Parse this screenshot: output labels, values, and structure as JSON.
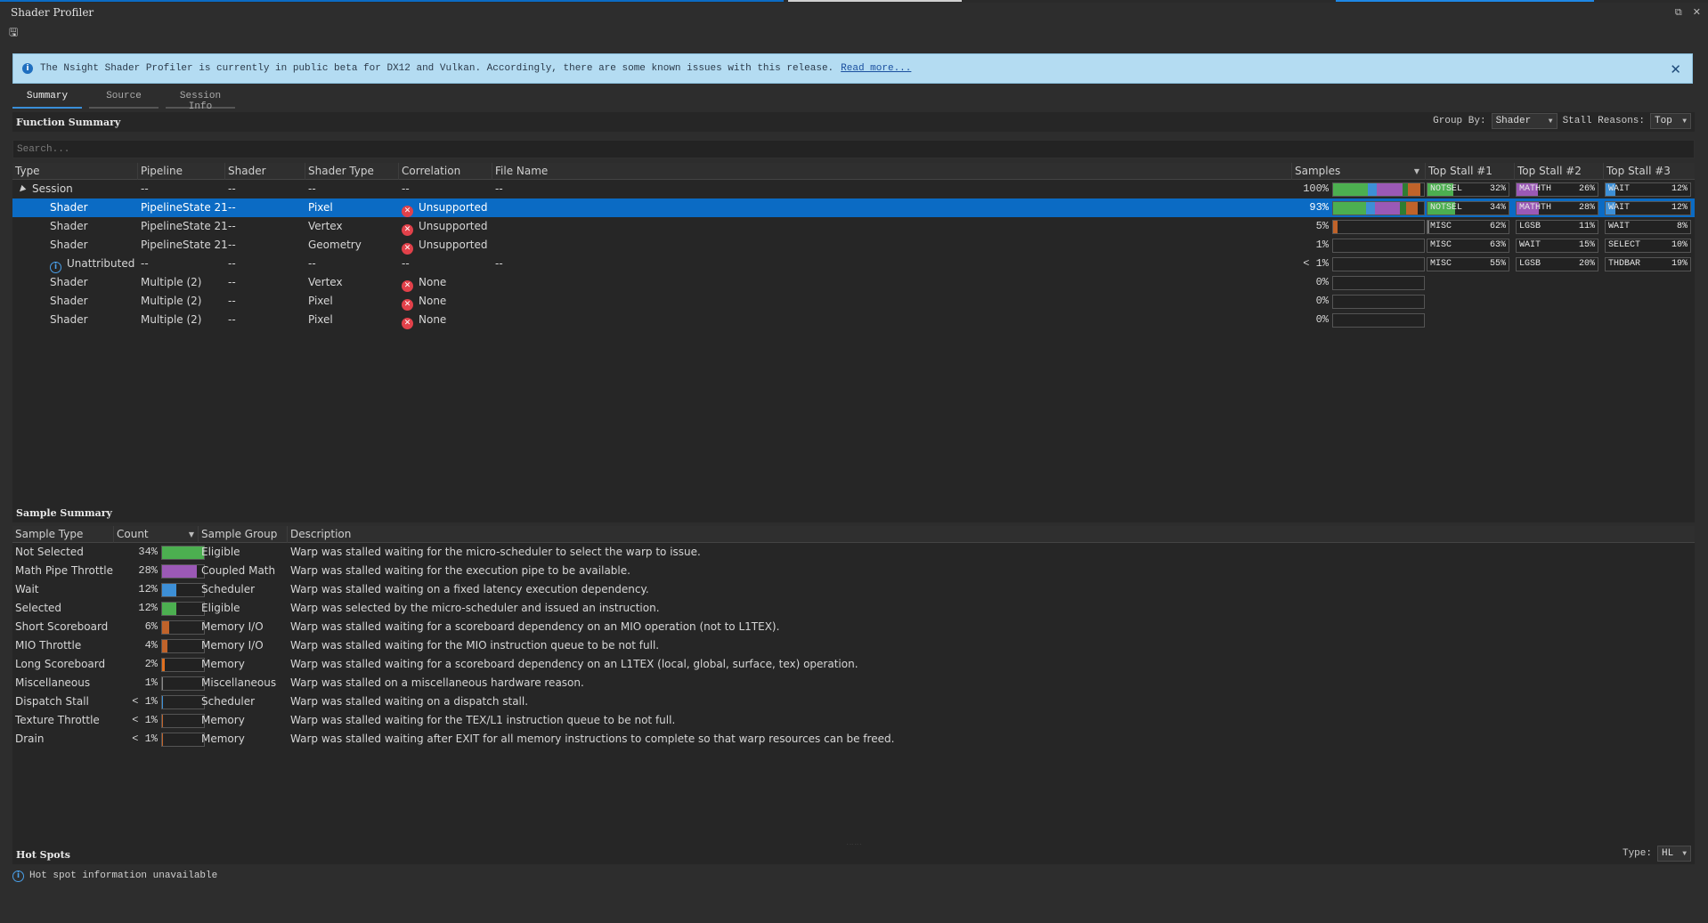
{
  "window": {
    "title": "Shader Profiler",
    "toolbar_icon": "save-icon"
  },
  "colors": {
    "accent": "#0b6bc4",
    "banner_bg": "#b4dcf2",
    "not_selected": "#4caf50",
    "math": "#9b59b6",
    "wait": "#3d8fd6",
    "memory": "#c0632a",
    "error": "#e2414a"
  },
  "banner": {
    "message": "The Nsight Shader Profiler is currently in public beta for DX12 and Vulkan. Accordingly, there are some known issues with this release.",
    "link": "Read more...",
    "close": "✕"
  },
  "tabs": [
    {
      "label": "Summary",
      "active": true
    },
    {
      "label": "Source",
      "active": false
    },
    {
      "label": "Session Info",
      "active": false
    }
  ],
  "function_summary": {
    "title": "Function Summary",
    "group_by_label": "Group By:",
    "group_by_value": "Shader",
    "stall_reasons_label": "Stall Reasons:",
    "stall_reasons_value": "Top",
    "search_placeholder": "Search...",
    "columns": {
      "type": "Type",
      "pipeline": "Pipeline",
      "shader": "Shader",
      "shader_type": "Shader Type",
      "correlation": "Correlation",
      "file_name": "File Name",
      "samples": "Samples",
      "top1": "Top Stall #1",
      "top2": "Top Stall #2",
      "top3": "Top Stall #3"
    },
    "rows": [
      {
        "type": "Session",
        "expander": true,
        "icon": "",
        "pipeline": "--",
        "shader": "--",
        "shader_type": "--",
        "correlation": "--",
        "correlation_error": false,
        "file_name": "--",
        "samples": "100%",
        "bar": [
          [
            "#4caf50",
            0.38
          ],
          [
            "#3d8fd6",
            0.1
          ],
          [
            "#9b59b6",
            0.28
          ],
          [
            "#2e7d32",
            0.06
          ],
          [
            "#c0632a",
            0.14
          ]
        ],
        "top1": {
          "name": "NOTSEL",
          "pct": "32%",
          "frac": 0.32,
          "color": "#4caf50"
        },
        "top2": {
          "name": "MATHTH",
          "pct": "26%",
          "frac": 0.26,
          "color": "#9b59b6"
        },
        "top3": {
          "name": "WAIT",
          "pct": "12%",
          "frac": 0.12,
          "color": "#3d8fd6"
        },
        "selected": false
      },
      {
        "type": "Shader",
        "expander": false,
        "icon": "",
        "pipeline": "PipelineState 21",
        "shader": "--",
        "shader_type": "Pixel",
        "correlation": "Unsupported",
        "correlation_error": true,
        "file_name": "",
        "samples": "93%",
        "bar": [
          [
            "#4caf50",
            0.36
          ],
          [
            "#3d8fd6",
            0.1
          ],
          [
            "#9b59b6",
            0.28
          ],
          [
            "#2e7d32",
            0.06
          ],
          [
            "#c0632a",
            0.13
          ]
        ],
        "top1": {
          "name": "NOTSEL",
          "pct": "34%",
          "frac": 0.34,
          "color": "#4caf50"
        },
        "top2": {
          "name": "MATHTH",
          "pct": "28%",
          "frac": 0.28,
          "color": "#9b59b6"
        },
        "top3": {
          "name": "WAIT",
          "pct": "12%",
          "frac": 0.12,
          "color": "#3d8fd6"
        },
        "selected": true
      },
      {
        "type": "Shader",
        "expander": false,
        "icon": "",
        "pipeline": "PipelineState 21",
        "shader": "--",
        "shader_type": "Vertex",
        "correlation": "Unsupported",
        "correlation_error": true,
        "file_name": "",
        "samples": "5%",
        "bar": [
          [
            "#c0632a",
            0.05
          ]
        ],
        "top1": {
          "name": "MISC",
          "pct": "62%",
          "frac": 0.02,
          "color": "#777777"
        },
        "top2": {
          "name": "LGSB",
          "pct": "11%",
          "frac": 0.0,
          "color": "#c0632a"
        },
        "top3": {
          "name": "WAIT",
          "pct": "8%",
          "frac": 0.0,
          "color": "#3d8fd6"
        },
        "selected": false
      },
      {
        "type": "Shader",
        "expander": false,
        "icon": "",
        "pipeline": "PipelineState 21",
        "shader": "--",
        "shader_type": "Geometry",
        "correlation": "Unsupported",
        "correlation_error": true,
        "file_name": "",
        "samples": "1%",
        "bar": [],
        "top1": {
          "name": "MISC",
          "pct": "63%",
          "frac": 0.0,
          "color": "#777777"
        },
        "top2": {
          "name": "WAIT",
          "pct": "15%",
          "frac": 0.0,
          "color": "#3d8fd6"
        },
        "top3": {
          "name": "SELECT",
          "pct": "10%",
          "frac": 0.0,
          "color": "#4caf50"
        },
        "selected": false
      },
      {
        "type": "Unattributed",
        "expander": false,
        "icon": "info",
        "pipeline": "--",
        "shader": "--",
        "shader_type": "--",
        "correlation": "--",
        "correlation_error": false,
        "file_name": "--",
        "samples": "< 1%",
        "bar": [],
        "top1": {
          "name": "MISC",
          "pct": "55%",
          "frac": 0.0,
          "color": "#777777"
        },
        "top2": {
          "name": "LGSB",
          "pct": "20%",
          "frac": 0.0,
          "color": "#c0632a"
        },
        "top3": {
          "name": "THDBAR",
          "pct": "19%",
          "frac": 0.0,
          "color": "#777777"
        },
        "selected": false
      },
      {
        "type": "Shader",
        "expander": false,
        "icon": "",
        "pipeline": "Multiple (2)",
        "shader": "--",
        "shader_type": "Vertex",
        "correlation": "None",
        "correlation_error": true,
        "file_name": "",
        "samples": "0%",
        "bar": [],
        "top1": null,
        "top2": null,
        "top3": null,
        "selected": false
      },
      {
        "type": "Shader",
        "expander": false,
        "icon": "",
        "pipeline": "Multiple (2)",
        "shader": "--",
        "shader_type": "Pixel",
        "correlation": "None",
        "correlation_error": true,
        "file_name": "",
        "samples": "0%",
        "bar": [],
        "top1": null,
        "top2": null,
        "top3": null,
        "selected": false
      },
      {
        "type": "Shader",
        "expander": false,
        "icon": "",
        "pipeline": "Multiple (2)",
        "shader": "--",
        "shader_type": "Pixel",
        "correlation": "None",
        "correlation_error": true,
        "file_name": "",
        "samples": "0%",
        "bar": [],
        "top1": null,
        "top2": null,
        "top3": null,
        "selected": false
      }
    ]
  },
  "sample_summary": {
    "title": "Sample Summary",
    "columns": {
      "sample_type": "Sample Type",
      "count": "Count",
      "sample_group": "Sample Group",
      "description": "Description"
    },
    "rows": [
      {
        "sample_type": "Not Selected",
        "count": "34%",
        "frac": 1.0,
        "color": "#4caf50",
        "group": "Eligible",
        "description": "Warp was stalled waiting for the micro-scheduler to select the warp to issue."
      },
      {
        "sample_type": "Math Pipe Throttle",
        "count": "28%",
        "frac": 0.82,
        "color": "#9b59b6",
        "group": "Coupled Math",
        "description": "Warp was stalled waiting for the execution pipe to be available."
      },
      {
        "sample_type": "Wait",
        "count": "12%",
        "frac": 0.35,
        "color": "#3d8fd6",
        "group": "Scheduler",
        "description": "Warp was stalled waiting on a fixed latency execution dependency."
      },
      {
        "sample_type": "Selected",
        "count": "12%",
        "frac": 0.35,
        "color": "#4caf50",
        "group": "Eligible",
        "description": "Warp was selected by the micro-scheduler and issued an instruction."
      },
      {
        "sample_type": "Short Scoreboard",
        "count": "6%",
        "frac": 0.18,
        "color": "#c0632a",
        "group": "Memory I/O",
        "description": "Warp was stalled waiting for a scoreboard dependency on an MIO operation (not to L1TEX)."
      },
      {
        "sample_type": "MIO Throttle",
        "count": "4%",
        "frac": 0.12,
        "color": "#c0632a",
        "group": "Memory I/O",
        "description": "Warp was stalled waiting for the MIO instruction queue to be not full."
      },
      {
        "sample_type": "Long Scoreboard",
        "count": "2%",
        "frac": 0.06,
        "color": "#e07020",
        "group": "Memory",
        "description": "Warp was stalled waiting for a scoreboard dependency on an L1TEX (local, global, surface, tex) operation."
      },
      {
        "sample_type": "Miscellaneous",
        "count": "1%",
        "frac": 0.03,
        "color": "#888888",
        "group": "Miscellaneous",
        "description": "Warp was stalled on a miscellaneous hardware reason."
      },
      {
        "sample_type": "Dispatch Stall",
        "count": "< 1%",
        "frac": 0.02,
        "color": "#3d8fd6",
        "group": "Scheduler",
        "description": "Warp was stalled waiting on a dispatch stall."
      },
      {
        "sample_type": "Texture Throttle",
        "count": "< 1%",
        "frac": 0.02,
        "color": "#c0632a",
        "group": "Memory",
        "description": "Warp was stalled waiting for the TEX/L1 instruction queue to be not full."
      },
      {
        "sample_type": "Drain",
        "count": "< 1%",
        "frac": 0.02,
        "color": "#c0632a",
        "group": "Memory",
        "description": "Warp was stalled waiting after EXIT for all memory instructions to complete so that warp resources can be freed."
      }
    ]
  },
  "hot_spots": {
    "title": "Hot Spots",
    "type_label": "Type:",
    "type_value": "HL",
    "message": "Hot spot information unavailable"
  }
}
